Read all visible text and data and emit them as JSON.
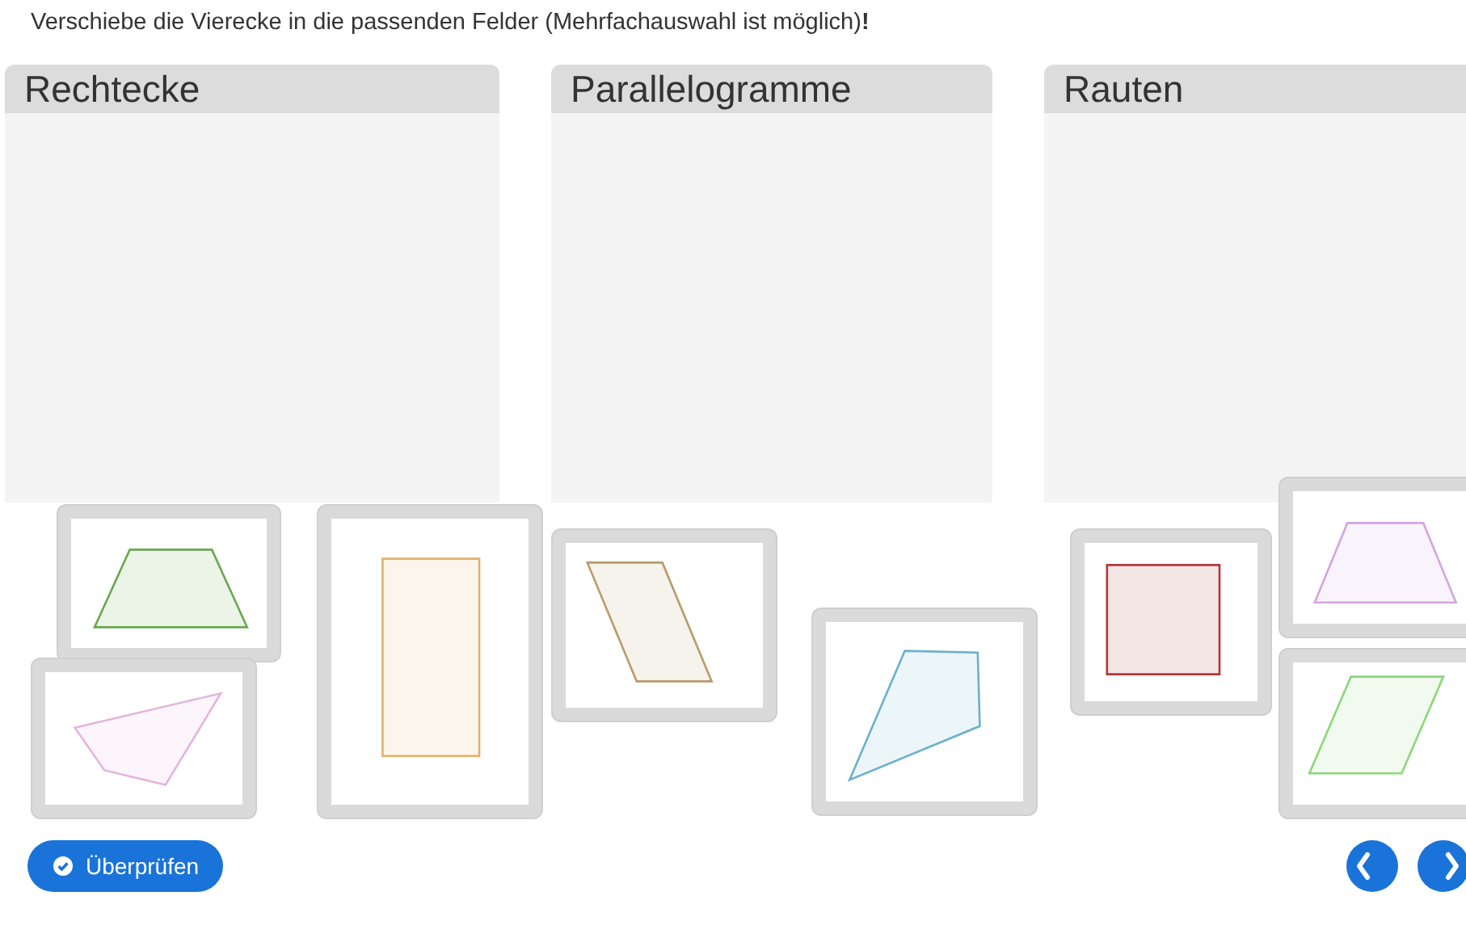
{
  "instruction": "Verschiebe die Vierecke in die passenden Felder (Mehrfachauswahl ist möglich)**!**",
  "drop_zones": [
    {
      "title": "Rechtecke"
    },
    {
      "title": "Parallelogramme"
    },
    {
      "title": "Rauten"
    }
  ],
  "cards": [
    {
      "kind": "trapezoid",
      "color": "#6aa84f"
    },
    {
      "kind": "quadrilateral",
      "color": "#e4b4de"
    },
    {
      "kind": "rectangle",
      "color": "#e3b06a"
    },
    {
      "kind": "parallelogram",
      "color": "#b89b6a"
    },
    {
      "kind": "irregular",
      "color": "#6ab0cc"
    },
    {
      "kind": "square",
      "color": "#b03a3a"
    },
    {
      "kind": "trapezoid",
      "color": "#d1a6e0"
    },
    {
      "kind": "rhombus",
      "color": "#8cd67a"
    }
  ],
  "check_button": {
    "label": "Überprüfen"
  },
  "nav_buttons": [
    {
      "kind": "previous"
    },
    {
      "kind": "next"
    }
  ]
}
